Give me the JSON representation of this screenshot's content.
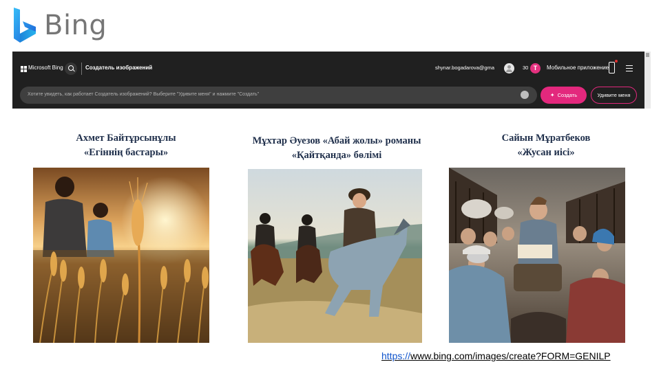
{
  "logo": {
    "text": "Bing"
  },
  "bing_create": {
    "brand": "Microsoft Bing",
    "title": "Создатель изображений",
    "user_email": "shynar.bogadarova@gmail.com",
    "coins": "30",
    "coin_letter": "Т",
    "mobile_app": "Мобильное приложение",
    "prompt_placeholder": "Хотите увидеть, как работает Создатель изображений? Выберите \"Удивите меня\" и нажмите \"Создать\"",
    "counter": "​",
    "create_button": "Создать",
    "surprise_button": "Удивите меня"
  },
  "cards": [
    {
      "caption_line1": "Ахмет Байтұрсынұлы",
      "caption_line2": "«Егіннің бастары»"
    },
    {
      "caption_line1": "Мұхтар Әуезов «Абай жолы» романы",
      "caption_line2": "«Қайтқанда» бөлімі"
    },
    {
      "caption_line1": "Сайын Мұратбеков",
      "caption_line2": "«Жусан иісі»"
    }
  ],
  "source_link": {
    "scheme": "https://",
    "rest": "www.bing.com/images/create?FORM=GENILP"
  },
  "colors": {
    "accent": "#e3287d",
    "caption": "#1e2e4a",
    "link": "#1155cc"
  },
  "icons": [
    "bing-logo-icon",
    "microsoft-grid-icon",
    "search-icon",
    "avatar-icon",
    "coin-icon",
    "phone-icon",
    "menu-icon",
    "image-upload-icon",
    "sparkle-icon"
  ]
}
